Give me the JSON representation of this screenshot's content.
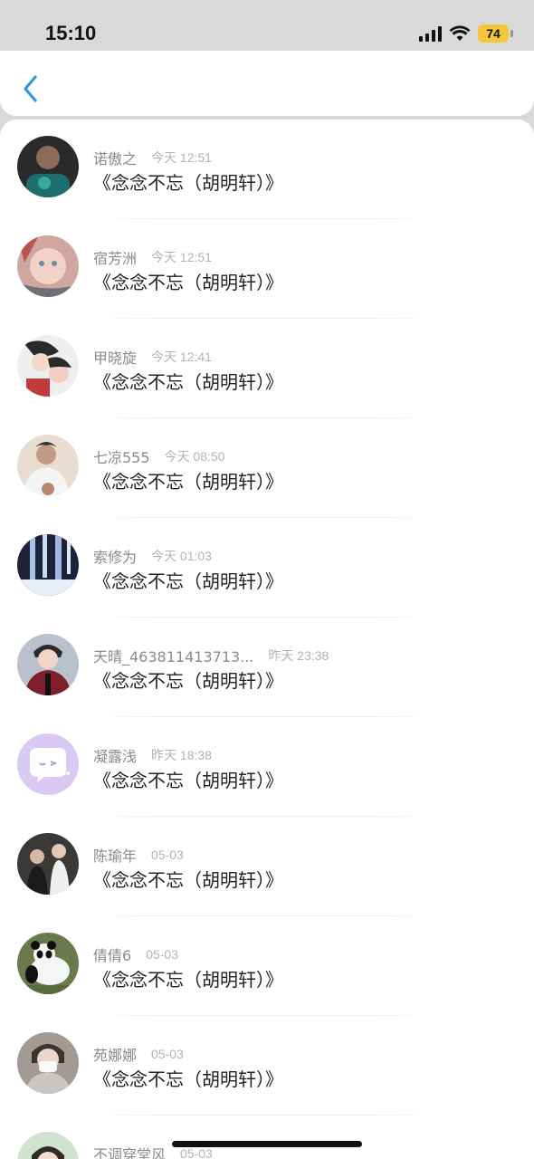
{
  "status_bar": {
    "time": "15:10",
    "battery": "74"
  },
  "nav": {
    "back_icon": "chevron-left-icon"
  },
  "colors": {
    "accent": "#2f9bd9",
    "battery": "#f4c73a"
  },
  "messages": [
    {
      "name": "诺傲之",
      "time": "今天 12:51",
      "text": "《念念不忘（胡明轩）》"
    },
    {
      "name": "宿芳洲",
      "time": "今天 12:51",
      "text": "《念念不忘（胡明轩）》"
    },
    {
      "name": "甲晓旋",
      "time": "今天 12:41",
      "text": "《念念不忘（胡明轩）》"
    },
    {
      "name": "七凉555",
      "time": "今天 08:50",
      "text": "《念念不忘（胡明轩）》"
    },
    {
      "name": "索修为",
      "time": "今天 01:03",
      "text": "《念念不忘（胡明轩）》"
    },
    {
      "name": "天晴_463811413713...",
      "time": "昨天 23:38",
      "text": "《念念不忘（胡明轩）》"
    },
    {
      "name": "凝露浅",
      "time": "昨天 18:38",
      "text": "《念念不忘（胡明轩）》"
    },
    {
      "name": "陈瑜年",
      "time": "05-03",
      "text": "《念念不忘（胡明轩）》"
    },
    {
      "name": "倩倩6",
      "time": "05-03",
      "text": "《念念不忘（胡明轩）》"
    },
    {
      "name": "苑娜娜",
      "time": "05-03",
      "text": "《念念不忘（胡明轩）》"
    },
    {
      "name": "不调穿堂风",
      "time": "05-03",
      "text": ""
    }
  ]
}
